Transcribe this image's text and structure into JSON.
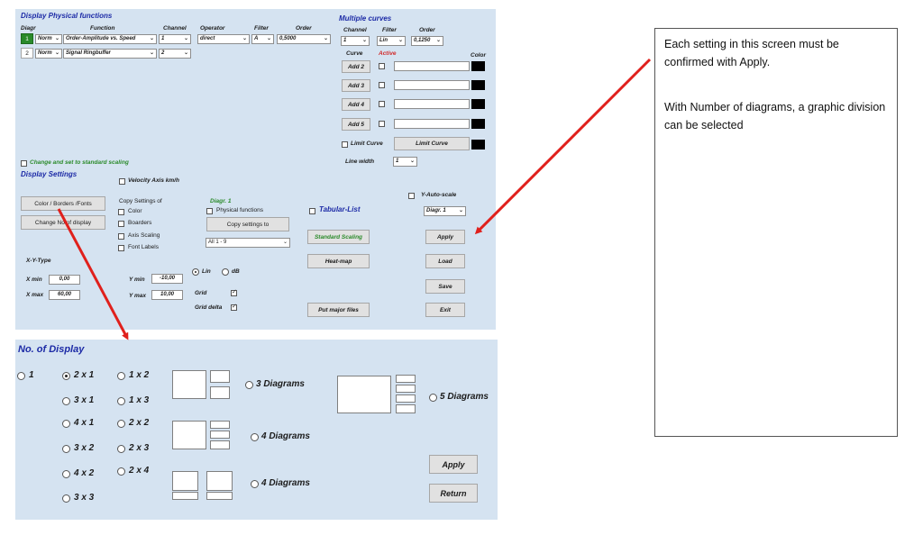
{
  "top_panel": {
    "display_physical_functions": {
      "title": "Display Physical functions",
      "headers": {
        "diagr": "Diagr",
        "function": "Function",
        "channel": "Channel",
        "operator": "Operator",
        "filter": "Filter",
        "order": "Order"
      },
      "rows": [
        {
          "diagr": "1",
          "norm": "Norm",
          "function": "Order-Amplitude vs. Speed",
          "channel": "1",
          "operator": "direct",
          "filter": "A",
          "order": "0,5000"
        },
        {
          "diagr": "2",
          "norm": "Norm",
          "function": "Signal Ringbuffer",
          "channel": "2"
        }
      ],
      "standard_scaling_label": "Change and set to standard scaling"
    },
    "multiple_curves": {
      "title": "Multiple curves",
      "channel_label": "Channel",
      "filter_label": "Filter",
      "order_label": "Order",
      "channel_value": "1",
      "filter_value": "Lin",
      "order_value": "0,1250",
      "curve_label": "Curve",
      "active_label": "Active",
      "color_label": "Color",
      "curves": [
        "Add 2",
        "Add 3",
        "Add 4",
        "Add 5"
      ],
      "limit_curve_check": "Limit Curve",
      "limit_curve_button": "Limit Curve",
      "line_width_label": "Line width",
      "line_width_value": "1"
    },
    "display_settings": {
      "title": "Display Settings",
      "velocity_axis": "Velocity Axis km/h",
      "color_borders_fonts": "Color / Borders /Fonts",
      "change_no_display": "Change No of display",
      "copy_settings_of": "Copy Settings of",
      "copy_opts": [
        "Color",
        "Boarders",
        "Axis Scaling",
        "Font Labels"
      ],
      "diagr_label": "Diagr. 1",
      "physical_functions": "Physical functions",
      "copy_settings_to": "Copy settings to",
      "all_range": "All 1 - 9",
      "tabular_list": "Tabular-List",
      "standard_scaling": "Standard Scaling",
      "heat_map": "Heat-map",
      "put_major_files": "Put major files",
      "y_auto_scale": "Y-Auto-scale",
      "diagr_select": "Diagr. 1",
      "apply": "Apply",
      "load": "Load",
      "save": "Save",
      "exit": "Exit",
      "xy_type": "X-Y-Type",
      "x_min_label": "X min",
      "x_min": "0,00",
      "x_max_label": "X max",
      "x_max": "60,00",
      "y_min_label": "Y min",
      "y_min": "-10,00",
      "y_max_label": "Y max",
      "y_max": "10,00",
      "lin": "Lin",
      "db": "dB",
      "grid": "Grid",
      "grid_delta": "Grid delta"
    }
  },
  "bottom_panel": {
    "title": "No. of Display",
    "options": {
      "o1": "1",
      "o2x1": "2 x 1",
      "o1x2": "1 x 2",
      "o3x1": "3 x 1",
      "o1x3": "1 x 3",
      "o4x1": "4 x 1",
      "o2x2": "2 x 2",
      "o3x2": "3 x 2",
      "o2x3": "2 x 3",
      "o4x2": "4 x 2",
      "o2x4": "2 x 4",
      "o3x3": "3 x 3"
    },
    "three_diagrams": "3 Diagrams",
    "four_diagrams_a": "4 Diagrams",
    "four_diagrams_b": "4 Diagrams",
    "five_diagrams": "5 Diagrams",
    "apply": "Apply",
    "return": "Return"
  },
  "note": {
    "line1": "Each setting in this screen must be confirmed with Apply.",
    "line2": "With Number of diagrams, a graphic division can be selected"
  },
  "colors": {
    "panel": "#d5e3f1",
    "title_blue": "#1c2aa6",
    "arrow_red": "#e0201c",
    "green": "#2a8a2a"
  }
}
